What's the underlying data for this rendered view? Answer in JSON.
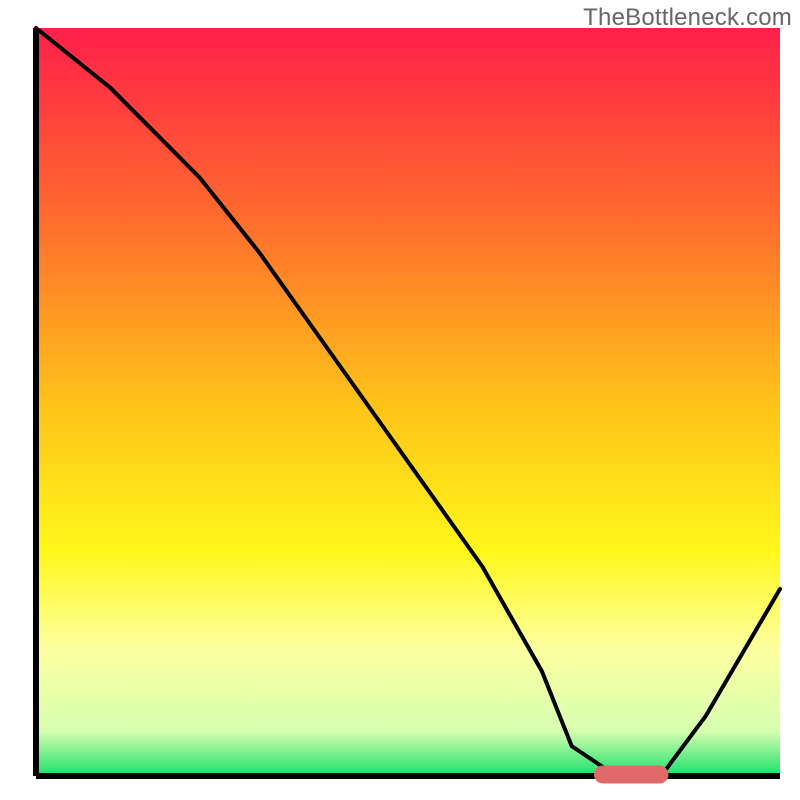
{
  "watermark": "TheBottleneck.com",
  "chart_data": {
    "type": "line",
    "title": "",
    "xlabel": "",
    "ylabel": "",
    "xlim": [
      0,
      100
    ],
    "ylim": [
      0,
      100
    ],
    "grid": false,
    "legend": false,
    "background_gradient": {
      "stops": [
        {
          "offset": 0,
          "color": "#ff1f4b"
        },
        {
          "offset": 25,
          "color": "#ff6a2e"
        },
        {
          "offset": 50,
          "color": "#ffc21a"
        },
        {
          "offset": 70,
          "color": "#fff71a"
        },
        {
          "offset": 83,
          "color": "#fdffa0"
        },
        {
          "offset": 94,
          "color": "#d7ffb0"
        },
        {
          "offset": 100,
          "color": "#19e06a"
        }
      ]
    },
    "curve": {
      "name": "bottleneck-curve",
      "x": [
        0,
        10,
        22,
        30,
        40,
        50,
        60,
        68,
        72,
        78,
        84,
        90,
        100
      ],
      "y": [
        100,
        92,
        80,
        70,
        56,
        42,
        28,
        14,
        4,
        0,
        0,
        8,
        25
      ]
    },
    "marker": {
      "name": "optimal-range",
      "type": "capsule",
      "x_start": 75,
      "x_end": 85,
      "y": 0.2,
      "color": "#e06a6a"
    }
  }
}
